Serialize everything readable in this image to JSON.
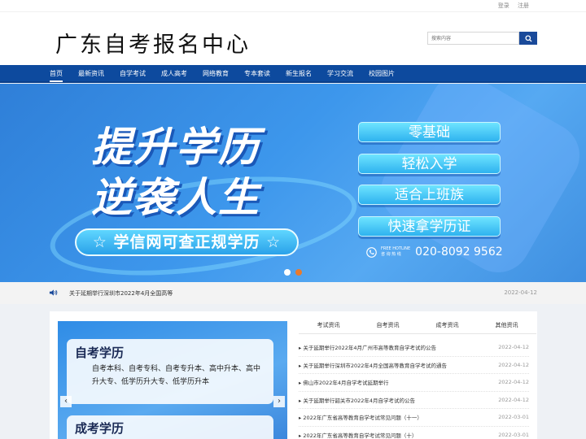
{
  "topbar": {
    "login": "登录",
    "register": "注册"
  },
  "header": {
    "logo": "广东自考报名中心",
    "search_placeholder": "搜索内容"
  },
  "nav": {
    "items": [
      "首页",
      "最新资讯",
      "自学考试",
      "成人高考",
      "网络教育",
      "专本套读",
      "新生报名",
      "学习交流",
      "校园图片"
    ]
  },
  "banner": {
    "line1": "提升学历",
    "line2": "逆袭人生",
    "pill": "☆ 学信网可查正规学历 ☆",
    "features": [
      "零基础",
      "轻松入学",
      "适合上班族",
      "快速拿学历证"
    ],
    "hotline_en": "FREE HOTLINE",
    "hotline_cn": "咨 询 热 线",
    "phone": "020-8092 9562"
  },
  "notice": {
    "text": "关于延期举行深圳市2022年4月全国高等",
    "date": "2022-04-12"
  },
  "promo": {
    "title1": "自考学历",
    "desc1": "自考本科、自考专科、自考专升本、高中升本、高中升大专、低学历升大专、低学历升本",
    "title2": "成考学历"
  },
  "tabs": [
    "考试资讯",
    "自考资讯",
    "成考资讯",
    "其他资讯"
  ],
  "news": [
    {
      "title": "关于延期举行2022年4月广州市高等教育自学考试的公告",
      "date": "2022-04-12"
    },
    {
      "title": "关于延期举行深圳市2022年4月全国高等教育自学考试的通告",
      "date": "2022-04-12"
    },
    {
      "title": "佛山市2022年4月自学考试延期举行",
      "date": "2022-04-12"
    },
    {
      "title": "关于延期举行韶关市2022年4月自学考试的公告",
      "date": "2022-04-12"
    },
    {
      "title": "2022年广东省高等教育自学考试常见问题（十一）",
      "date": "2022-03-01"
    },
    {
      "title": "2022年广东省高等教育自学考试常见问题（十）",
      "date": "2022-03-01"
    }
  ],
  "colors": {
    "nav": "#0d4a9e",
    "accent": "#1a4a9a",
    "dot_active": "#e87a2c"
  }
}
